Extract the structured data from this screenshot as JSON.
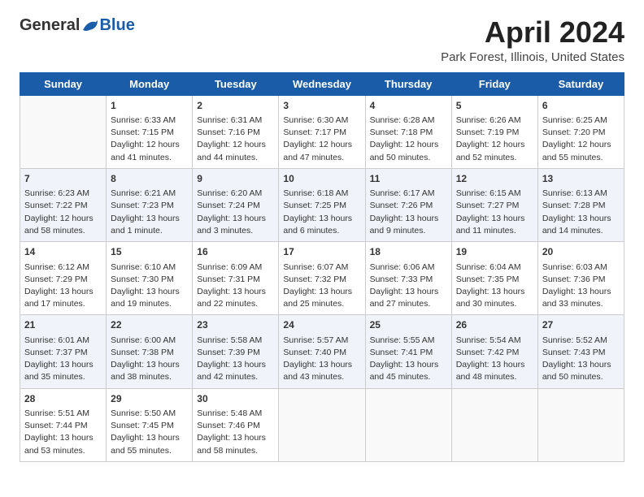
{
  "header": {
    "logo_general": "General",
    "logo_blue": "Blue",
    "month_title": "April 2024",
    "location": "Park Forest, Illinois, United States"
  },
  "weekdays": [
    "Sunday",
    "Monday",
    "Tuesday",
    "Wednesday",
    "Thursday",
    "Friday",
    "Saturday"
  ],
  "weeks": [
    [
      {
        "day": "",
        "sunrise": "",
        "sunset": "",
        "daylight": ""
      },
      {
        "day": "1",
        "sunrise": "Sunrise: 6:33 AM",
        "sunset": "Sunset: 7:15 PM",
        "daylight": "Daylight: 12 hours and 41 minutes."
      },
      {
        "day": "2",
        "sunrise": "Sunrise: 6:31 AM",
        "sunset": "Sunset: 7:16 PM",
        "daylight": "Daylight: 12 hours and 44 minutes."
      },
      {
        "day": "3",
        "sunrise": "Sunrise: 6:30 AM",
        "sunset": "Sunset: 7:17 PM",
        "daylight": "Daylight: 12 hours and 47 minutes."
      },
      {
        "day": "4",
        "sunrise": "Sunrise: 6:28 AM",
        "sunset": "Sunset: 7:18 PM",
        "daylight": "Daylight: 12 hours and 50 minutes."
      },
      {
        "day": "5",
        "sunrise": "Sunrise: 6:26 AM",
        "sunset": "Sunset: 7:19 PM",
        "daylight": "Daylight: 12 hours and 52 minutes."
      },
      {
        "day": "6",
        "sunrise": "Sunrise: 6:25 AM",
        "sunset": "Sunset: 7:20 PM",
        "daylight": "Daylight: 12 hours and 55 minutes."
      }
    ],
    [
      {
        "day": "7",
        "sunrise": "Sunrise: 6:23 AM",
        "sunset": "Sunset: 7:22 PM",
        "daylight": "Daylight: 12 hours and 58 minutes."
      },
      {
        "day": "8",
        "sunrise": "Sunrise: 6:21 AM",
        "sunset": "Sunset: 7:23 PM",
        "daylight": "Daylight: 13 hours and 1 minute."
      },
      {
        "day": "9",
        "sunrise": "Sunrise: 6:20 AM",
        "sunset": "Sunset: 7:24 PM",
        "daylight": "Daylight: 13 hours and 3 minutes."
      },
      {
        "day": "10",
        "sunrise": "Sunrise: 6:18 AM",
        "sunset": "Sunset: 7:25 PM",
        "daylight": "Daylight: 13 hours and 6 minutes."
      },
      {
        "day": "11",
        "sunrise": "Sunrise: 6:17 AM",
        "sunset": "Sunset: 7:26 PM",
        "daylight": "Daylight: 13 hours and 9 minutes."
      },
      {
        "day": "12",
        "sunrise": "Sunrise: 6:15 AM",
        "sunset": "Sunset: 7:27 PM",
        "daylight": "Daylight: 13 hours and 11 minutes."
      },
      {
        "day": "13",
        "sunrise": "Sunrise: 6:13 AM",
        "sunset": "Sunset: 7:28 PM",
        "daylight": "Daylight: 13 hours and 14 minutes."
      }
    ],
    [
      {
        "day": "14",
        "sunrise": "Sunrise: 6:12 AM",
        "sunset": "Sunset: 7:29 PM",
        "daylight": "Daylight: 13 hours and 17 minutes."
      },
      {
        "day": "15",
        "sunrise": "Sunrise: 6:10 AM",
        "sunset": "Sunset: 7:30 PM",
        "daylight": "Daylight: 13 hours and 19 minutes."
      },
      {
        "day": "16",
        "sunrise": "Sunrise: 6:09 AM",
        "sunset": "Sunset: 7:31 PM",
        "daylight": "Daylight: 13 hours and 22 minutes."
      },
      {
        "day": "17",
        "sunrise": "Sunrise: 6:07 AM",
        "sunset": "Sunset: 7:32 PM",
        "daylight": "Daylight: 13 hours and 25 minutes."
      },
      {
        "day": "18",
        "sunrise": "Sunrise: 6:06 AM",
        "sunset": "Sunset: 7:33 PM",
        "daylight": "Daylight: 13 hours and 27 minutes."
      },
      {
        "day": "19",
        "sunrise": "Sunrise: 6:04 AM",
        "sunset": "Sunset: 7:35 PM",
        "daylight": "Daylight: 13 hours and 30 minutes."
      },
      {
        "day": "20",
        "sunrise": "Sunrise: 6:03 AM",
        "sunset": "Sunset: 7:36 PM",
        "daylight": "Daylight: 13 hours and 33 minutes."
      }
    ],
    [
      {
        "day": "21",
        "sunrise": "Sunrise: 6:01 AM",
        "sunset": "Sunset: 7:37 PM",
        "daylight": "Daylight: 13 hours and 35 minutes."
      },
      {
        "day": "22",
        "sunrise": "Sunrise: 6:00 AM",
        "sunset": "Sunset: 7:38 PM",
        "daylight": "Daylight: 13 hours and 38 minutes."
      },
      {
        "day": "23",
        "sunrise": "Sunrise: 5:58 AM",
        "sunset": "Sunset: 7:39 PM",
        "daylight": "Daylight: 13 hours and 42 minutes."
      },
      {
        "day": "24",
        "sunrise": "Sunrise: 5:57 AM",
        "sunset": "Sunset: 7:40 PM",
        "daylight": "Daylight: 13 hours and 43 minutes."
      },
      {
        "day": "25",
        "sunrise": "Sunrise: 5:55 AM",
        "sunset": "Sunset: 7:41 PM",
        "daylight": "Daylight: 13 hours and 45 minutes."
      },
      {
        "day": "26",
        "sunrise": "Sunrise: 5:54 AM",
        "sunset": "Sunset: 7:42 PM",
        "daylight": "Daylight: 13 hours and 48 minutes."
      },
      {
        "day": "27",
        "sunrise": "Sunrise: 5:52 AM",
        "sunset": "Sunset: 7:43 PM",
        "daylight": "Daylight: 13 hours and 50 minutes."
      }
    ],
    [
      {
        "day": "28",
        "sunrise": "Sunrise: 5:51 AM",
        "sunset": "Sunset: 7:44 PM",
        "daylight": "Daylight: 13 hours and 53 minutes."
      },
      {
        "day": "29",
        "sunrise": "Sunrise: 5:50 AM",
        "sunset": "Sunset: 7:45 PM",
        "daylight": "Daylight: 13 hours and 55 minutes."
      },
      {
        "day": "30",
        "sunrise": "Sunrise: 5:48 AM",
        "sunset": "Sunset: 7:46 PM",
        "daylight": "Daylight: 13 hours and 58 minutes."
      },
      {
        "day": "",
        "sunrise": "",
        "sunset": "",
        "daylight": ""
      },
      {
        "day": "",
        "sunrise": "",
        "sunset": "",
        "daylight": ""
      },
      {
        "day": "",
        "sunrise": "",
        "sunset": "",
        "daylight": ""
      },
      {
        "day": "",
        "sunrise": "",
        "sunset": "",
        "daylight": ""
      }
    ]
  ]
}
